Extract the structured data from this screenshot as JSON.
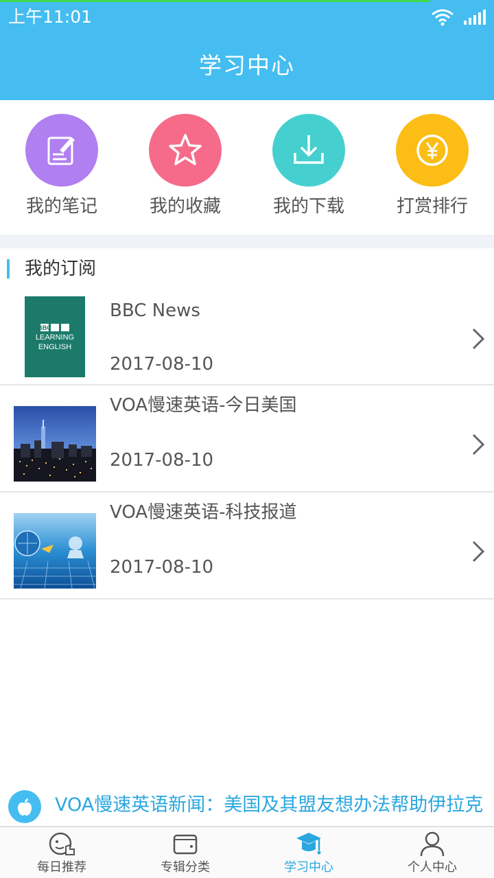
{
  "status_bar": {
    "time": "上午11:01"
  },
  "header": {
    "title": "学习中心"
  },
  "quick_actions": [
    {
      "label": "我的笔记",
      "icon": "note-edit-icon",
      "color": "#b07ff0"
    },
    {
      "label": "我的收藏",
      "icon": "star-icon",
      "color": "#f56b89"
    },
    {
      "label": "我的下载",
      "icon": "download-icon",
      "color": "#45d0cf"
    },
    {
      "label": "打赏排行",
      "icon": "yen-coin-icon",
      "color": "#fbbd16"
    }
  ],
  "subscriptions": {
    "title": "我的订阅",
    "items": [
      {
        "title": "BBC News",
        "date": "2017-08-10",
        "thumb_lines": [
          "BBC",
          "LEARNING",
          "ENGLISH"
        ]
      },
      {
        "title": "VOA慢速英语-今日美国",
        "date": "2017-08-10"
      },
      {
        "title": "VOA慢速英语-科技报道",
        "date": "2017-08-10"
      }
    ]
  },
  "ticker": {
    "text": "VOA慢速英语新闻：美国及其盟友想办法帮助伊拉克"
  },
  "bottom_nav": [
    {
      "label": "每日推荐",
      "icon": "daily-recommend-icon"
    },
    {
      "label": "专辑分类",
      "icon": "wallet-icon"
    },
    {
      "label": "学习中心",
      "icon": "graduation-cap-icon",
      "active": true
    },
    {
      "label": "个人中心",
      "icon": "user-icon"
    }
  ],
  "colors": {
    "accent": "#45bdf0",
    "active_text": "#2aa7df"
  }
}
